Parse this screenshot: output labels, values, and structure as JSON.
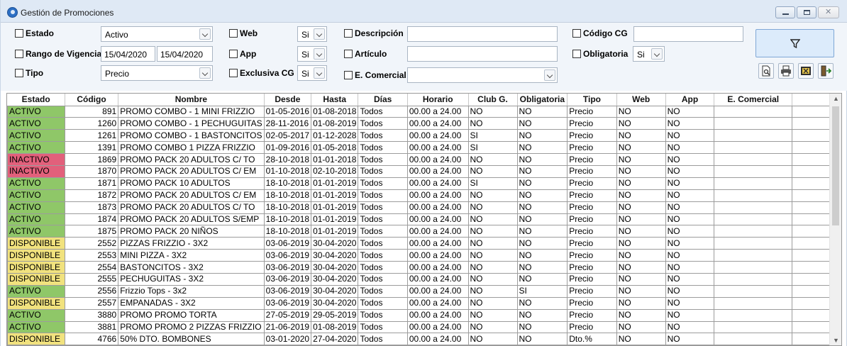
{
  "window": {
    "title": "Gestión de Promociones",
    "close_glyph": "✕"
  },
  "filters": {
    "estado": {
      "label": "Estado",
      "value": "Activo"
    },
    "rango": {
      "label": "Rango de Vigencia",
      "desde": "15/04/2020",
      "hasta": "15/04/2020"
    },
    "tipo": {
      "label": "Tipo",
      "value": "Precio"
    },
    "web": {
      "label": "Web",
      "value": "Si"
    },
    "app": {
      "label": "App",
      "value": "Si"
    },
    "exclusiva": {
      "label": "Exclusiva CG",
      "value": "Si"
    },
    "descripcion": {
      "label": "Descripción",
      "value": ""
    },
    "articulo": {
      "label": "Artículo",
      "value": ""
    },
    "comercial": {
      "label": "E. Comercial",
      "value": ""
    },
    "codigo_cg": {
      "label": "Código CG",
      "value": ""
    },
    "obligatoria": {
      "label": "Obligatoria",
      "value": "Si"
    }
  },
  "toolbar_icons": [
    "filter-icon",
    "print-preview-icon",
    "printer-icon",
    "export-excel-icon",
    "exit-icon"
  ],
  "status_colors": {
    "ACTIVO": "#8fc768",
    "INACTIVO": "#e2607b",
    "DISPONIBLE": "#f1e27e"
  },
  "table": {
    "columns": [
      "Estado",
      "Código",
      "Nombre",
      "Desde",
      "Hasta",
      "Días",
      "Horario",
      "Club G.",
      "Obligatoria",
      "Tipo",
      "Web",
      "App",
      "E. Comercial",
      ""
    ],
    "rows": [
      [
        "ACTIVO",
        "891",
        "PROMO COMBO - 1 MINI FRIZZIO",
        "01-05-2016",
        "01-08-2018",
        "Todos",
        "00.00 a 24.00",
        "NO",
        "NO",
        "Precio",
        "NO",
        "NO",
        "",
        ""
      ],
      [
        "ACTIVO",
        "1260",
        "PROMO COMBO - 1 PECHUGUITAS",
        "28-11-2016",
        "01-08-2019",
        "Todos",
        "00.00 a 24.00",
        "NO",
        "NO",
        "Precio",
        "NO",
        "NO",
        "",
        ""
      ],
      [
        "ACTIVO",
        "1261",
        "PROMO COMBO - 1 BASTONCITOS",
        "02-05-2017",
        "01-12-2028",
        "Todos",
        "00.00 a 24.00",
        "SI",
        "NO",
        "Precio",
        "NO",
        "NO",
        "",
        ""
      ],
      [
        "ACTIVO",
        "1391",
        "PROMO COMBO 1 PIZZA FRIZZIO",
        "01-09-2016",
        "01-05-2018",
        "Todos",
        "00.00 a 24.00",
        "SI",
        "NO",
        "Precio",
        "NO",
        "NO",
        "",
        ""
      ],
      [
        "INACTIVO",
        "1869",
        "PROMO PACK 20 ADULTOS C/ TO",
        "28-10-2018",
        "01-01-2018",
        "Todos",
        "00.00 a 24.00",
        "NO",
        "NO",
        "Precio",
        "NO",
        "NO",
        "",
        ""
      ],
      [
        "INACTIVO",
        "1870",
        "PROMO PACK 20 ADULTOS C/ EM",
        "01-10-2018",
        "02-10-2018",
        "Todos",
        "00.00 a 24.00",
        "NO",
        "NO",
        "Precio",
        "NO",
        "NO",
        "",
        ""
      ],
      [
        "ACTIVO",
        "1871",
        "PROMO PACK 10 ADULTOS",
        "18-10-2018",
        "01-01-2019",
        "Todos",
        "00.00 a 24.00",
        "SI",
        "NO",
        "Precio",
        "NO",
        "NO",
        "",
        ""
      ],
      [
        "ACTIVO",
        "1872",
        "PROMO PACK 20 ADULTOS C/ EM",
        "18-10-2018",
        "01-01-2019",
        "Todos",
        "00.00 a 24.00",
        "NO",
        "NO",
        "Precio",
        "NO",
        "NO",
        "",
        ""
      ],
      [
        "ACTIVO",
        "1873",
        "PROMO PACK 20 ADULTOS C/ TO",
        "18-10-2018",
        "01-01-2019",
        "Todos",
        "00.00 a 24.00",
        "NO",
        "NO",
        "Precio",
        "NO",
        "NO",
        "",
        ""
      ],
      [
        "ACTIVO",
        "1874",
        "PROMO PACK 20 ADULTOS S/EMP",
        "18-10-2018",
        "01-01-2019",
        "Todos",
        "00.00 a 24.00",
        "NO",
        "NO",
        "Precio",
        "NO",
        "NO",
        "",
        ""
      ],
      [
        "ACTIVO",
        "1875",
        "PROMO PACK 20 NIÑOS",
        "18-10-2018",
        "01-01-2019",
        "Todos",
        "00.00 a 24.00",
        "NO",
        "NO",
        "Precio",
        "NO",
        "NO",
        "",
        ""
      ],
      [
        "DISPONIBLE",
        "2552",
        "PIZZAS FRIZZIO - 3X2",
        "03-06-2019",
        "30-04-2020",
        "Todos",
        "00.00 a 24.00",
        "NO",
        "NO",
        "Precio",
        "NO",
        "NO",
        "",
        ""
      ],
      [
        "DISPONIBLE",
        "2553",
        "MINI PIZZA - 3X2",
        "03-06-2019",
        "30-04-2020",
        "Todos",
        "00.00 a 24.00",
        "NO",
        "NO",
        "Precio",
        "NO",
        "NO",
        "",
        ""
      ],
      [
        "DISPONIBLE",
        "2554",
        "BASTONCITOS - 3X2",
        "03-06-2019",
        "30-04-2020",
        "Todos",
        "00.00 a 24.00",
        "NO",
        "NO",
        "Precio",
        "NO",
        "NO",
        "",
        ""
      ],
      [
        "DISPONIBLE",
        "2555",
        "PECHUGUITAS - 3X2",
        "03-06-2019",
        "30-04-2020",
        "Todos",
        "00.00 a 24.00",
        "NO",
        "NO",
        "Precio",
        "NO",
        "NO",
        "",
        ""
      ],
      [
        "ACTIVO",
        "2556",
        "Frizzio Tops - 3x2",
        "03-06-2019",
        "30-04-2020",
        "Todos",
        "00.00 a 24.00",
        "NO",
        "SI",
        "Precio",
        "NO",
        "NO",
        "",
        ""
      ],
      [
        "DISPONIBLE",
        "2557",
        "EMPANADAS - 3X2",
        "03-06-2019",
        "30-04-2020",
        "Todos",
        "00.00 a 24.00",
        "NO",
        "NO",
        "Precio",
        "NO",
        "NO",
        "",
        ""
      ],
      [
        "ACTIVO",
        "3880",
        "PROMO PROMO TORTA",
        "27-05-2019",
        "29-05-2019",
        "Todos",
        "00.00 a 24.00",
        "NO",
        "NO",
        "Precio",
        "NO",
        "NO",
        "",
        ""
      ],
      [
        "ACTIVO",
        "3881",
        "PROMO PROMO 2 PIZZAS FRIZZIO",
        "21-06-2019",
        "01-08-2019",
        "Todos",
        "00.00 a 24.00",
        "NO",
        "NO",
        "Precio",
        "NO",
        "NO",
        "",
        ""
      ],
      [
        "DISPONIBLE",
        "4766",
        "50% DTO. BOMBONES",
        "03-01-2020",
        "27-04-2020",
        "Todos",
        "00.00 a 24.00",
        "NO",
        "NO",
        "Dto.%",
        "NO",
        "NO",
        "",
        ""
      ]
    ]
  }
}
